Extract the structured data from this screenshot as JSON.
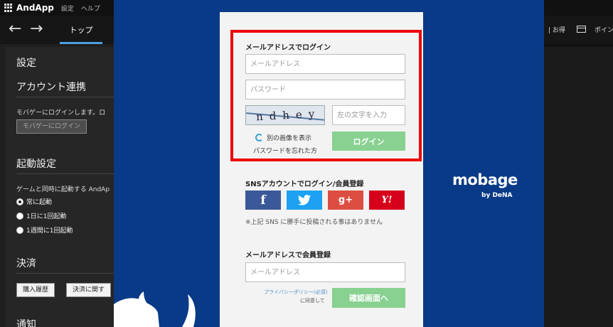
{
  "background_app": {
    "app_name": "AndApp",
    "menu": [
      "設定",
      "ヘルプ"
    ],
    "nav_back": "←",
    "nav_forward": "→",
    "tab_top": "トップ",
    "settings_title": "設定",
    "account_section": "アカウント連携",
    "account_desc": "モバゲーにログインします。ロ",
    "mobage_login_button": "モバゲーにログイン",
    "startup_section": "起動設定",
    "startup_desc": "ゲームと同時に起動する AndAp",
    "radio_options": [
      "常に起動",
      "1日に1回起動",
      "1週間に1回起動"
    ],
    "payment_section": "決済",
    "purchase_history_button": "購入履歴",
    "payment_about_button": "決済に関す",
    "notice_section": "通知"
  },
  "background_right": {
    "label_otoku": "| お得",
    "label_point": "ポイン"
  },
  "login": {
    "email_login_label": "メールアドレスでログイン",
    "email_placeholder": "メールアドレス",
    "password_placeholder": "パスワード",
    "captcha_text": "ndhey",
    "captcha_placeholder": "左の文字を入力",
    "refresh_image_link": "別の画像を表示",
    "forgot_password_link": "パスワードを忘れた方",
    "login_button": "ログイン"
  },
  "sns": {
    "label": "SNSアカウントでログイン/会員登録",
    "buttons": [
      "f",
      "t",
      "g+",
      "Y!"
    ],
    "colors": [
      "#3b5998",
      "#1da1f2",
      "#dc4e41",
      "#d6001b"
    ],
    "note": "※上記 SNS に勝手に投稿される事はありません"
  },
  "register": {
    "label": "メールアドレスで会員登録",
    "email_placeholder": "メールアドレス",
    "privacy_link": "プライバシーポリシー(必須)",
    "agree_text": "に同意して",
    "confirm_button": "確認画面へ"
  },
  "branding": {
    "logo": "mobage",
    "by": "by DeNA"
  },
  "colors": {
    "overlay_bg": "#093a87",
    "highlight": "#e00000",
    "green_button": "#88d191"
  }
}
